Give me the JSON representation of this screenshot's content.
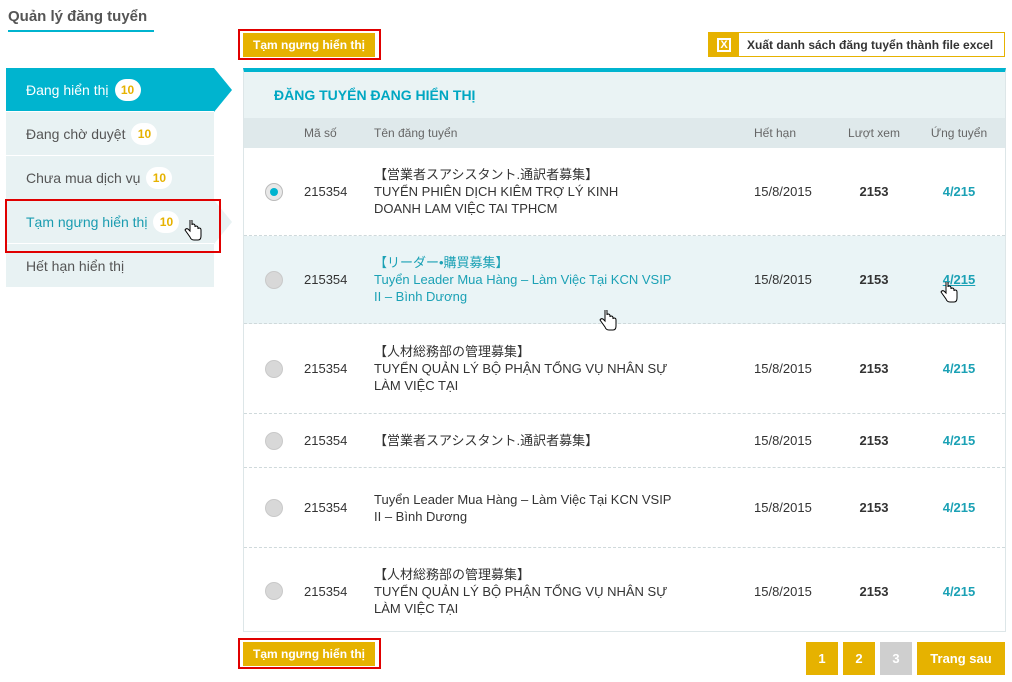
{
  "page": {
    "title": "Quản lý đăng tuyển"
  },
  "actions": {
    "suspend_top": "Tạm ngưng hiển thị",
    "suspend_bottom": "Tạm ngưng hiển thị",
    "export_excel": "Xuất danh sách đăng tuyển thành file excel",
    "export_icon": "X"
  },
  "sidebar": {
    "items": [
      {
        "label": "Đang hiển thị",
        "count": "10"
      },
      {
        "label": "Đang chờ duyệt",
        "count": "10"
      },
      {
        "label": "Chưa mua dịch vụ",
        "count": "10"
      },
      {
        "label": "Tạm ngưng hiển thị",
        "count": "10"
      },
      {
        "label": "Hết hạn hiển thị"
      }
    ]
  },
  "panel": {
    "title": "ĐĂNG TUYỂN ĐANG HIỂN THỊ",
    "columns": {
      "id": "Mã số",
      "name": "Tên đăng tuyển",
      "expiry": "Hết hạn",
      "views": "Lượt xem",
      "apply": "Ứng tuyển"
    },
    "rows": [
      {
        "id": "215354",
        "line1": "【営業者スアシスタント.通訳者募集】",
        "line2": "TUYỂN PHIÊN DỊCH KIÊM TRỢ LÝ KINH",
        "line3": "DOANH LAM VIỆC TAI TPHCM",
        "expiry": "15/8/2015",
        "views": "2153",
        "apply": "4/215"
      },
      {
        "id": "215354",
        "line1": "【リーダー•購買募集】",
        "line2": "Tuyển Leader Mua Hàng – Làm Việc Tại KCN VSIP",
        "line3": "II – Bình Dương",
        "expiry": "15/8/2015",
        "views": "2153",
        "apply": "4/215"
      },
      {
        "id": "215354",
        "line1": "【人材総務部の管理募集】",
        "line2": "TUYỂN QUẢN LÝ BỘ PHẬN TỔNG VỤ NHÂN SỰ",
        "line3": "LÀM VIỆC TẠI",
        "expiry": "15/8/2015",
        "views": "2153",
        "apply": "4/215"
      },
      {
        "id": "215354",
        "line1": "【営業者スアシスタント.通訳者募集】",
        "expiry": "15/8/2015",
        "views": "2153",
        "apply": "4/215"
      },
      {
        "id": "215354",
        "line1": "Tuyển Leader Mua Hàng – Làm Việc Tại KCN VSIP",
        "line2": "II – Bình Dương",
        "expiry": "15/8/2015",
        "views": "2153",
        "apply": "4/215"
      },
      {
        "id": "215354",
        "line1": "【人材総務部の管理募集】",
        "line2": "TUYỂN QUẢN LÝ BỘ PHẬN TỔNG VỤ NHÂN SỰ",
        "line3": "LÀM VIỆC TẠI",
        "expiry": "15/8/2015",
        "views": "2153",
        "apply": "4/215"
      }
    ]
  },
  "pagination": {
    "pages": [
      "1",
      "2",
      "3"
    ],
    "next": "Trang sau"
  },
  "colors": {
    "accent": "#00b4cf",
    "button": "#e6b200",
    "highlight": "#e00000"
  }
}
